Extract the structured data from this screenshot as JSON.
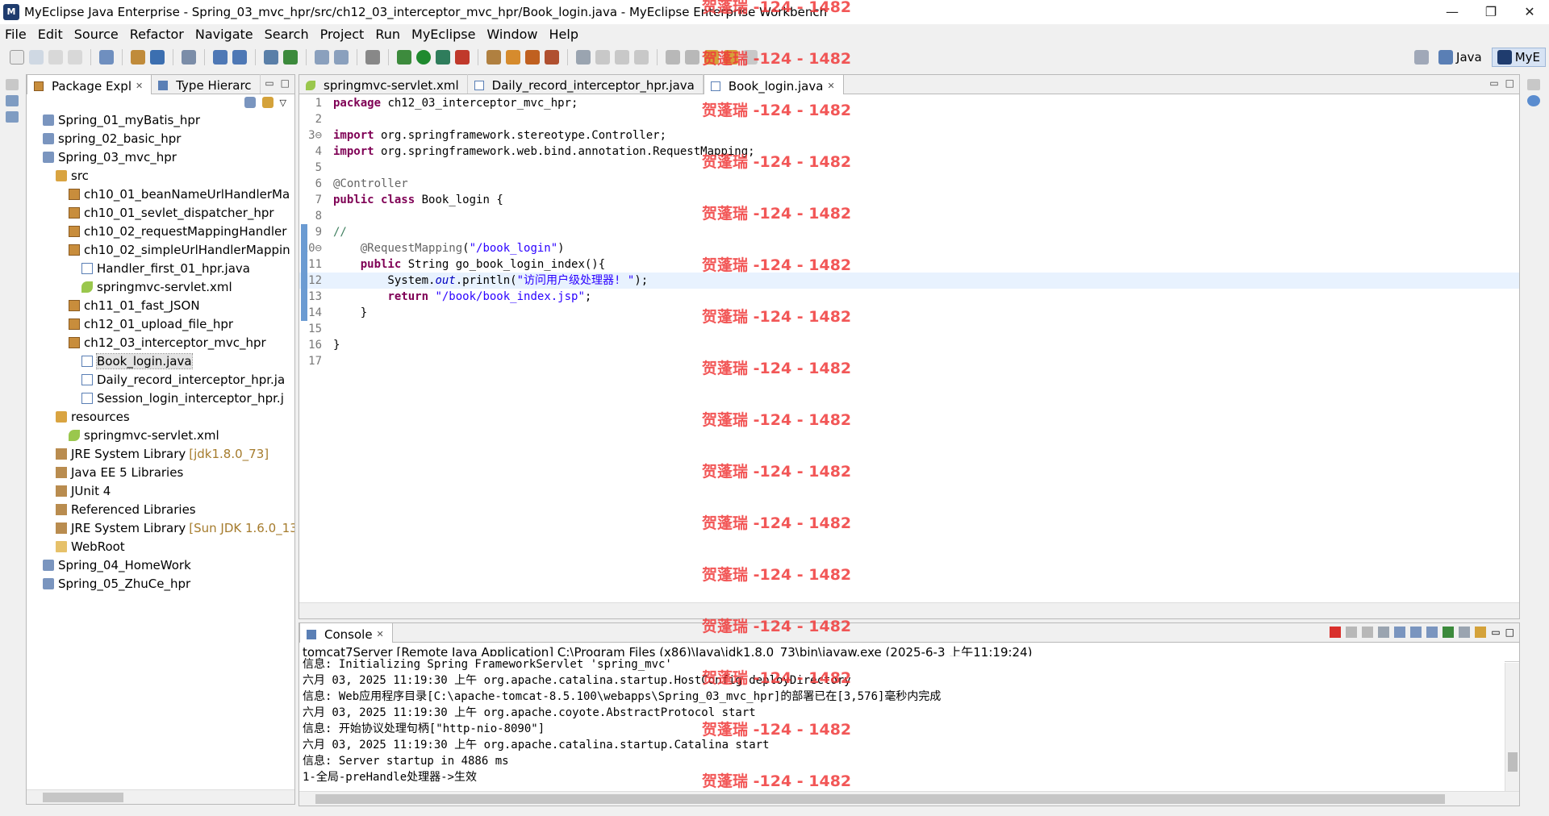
{
  "window": {
    "title": "MyEclipse Java Enterprise - Spring_03_mvc_hpr/src/ch12_03_interceptor_mvc_hpr/Book_login.java - MyEclipse Enterprise Workbench",
    "minimize": "—",
    "maximize": "❐",
    "close": "✕"
  },
  "menu": [
    "File",
    "Edit",
    "Source",
    "Refactor",
    "Navigate",
    "Search",
    "Project",
    "Run",
    "MyEclipse",
    "Window",
    "Help"
  ],
  "perspectives": {
    "java": "Java",
    "myeclipse": "MyE"
  },
  "explorer": {
    "tabs": [
      "Package Expl",
      "Type Hierarc"
    ],
    "tree": [
      {
        "label": "Spring_01_myBatis_hpr",
        "depth": 1,
        "icon": "project-icon"
      },
      {
        "label": "spring_02_basic_hpr",
        "depth": 1,
        "icon": "project-icon"
      },
      {
        "label": "Spring_03_mvc_hpr",
        "depth": 1,
        "icon": "project-icon"
      },
      {
        "label": "src",
        "depth": 2,
        "icon": "source-folder-icon"
      },
      {
        "label": "ch10_01_beanNameUrlHandlerMa",
        "depth": 3,
        "icon": "package-icon"
      },
      {
        "label": "ch10_01_sevlet_dispatcher_hpr",
        "depth": 3,
        "icon": "package-icon"
      },
      {
        "label": "ch10_02_requestMappingHandler",
        "depth": 3,
        "icon": "package-icon"
      },
      {
        "label": "ch10_02_simpleUrlHandlerMappin",
        "depth": 3,
        "icon": "package-icon"
      },
      {
        "label": "Handler_first_01_hpr.java",
        "depth": 4,
        "icon": "java-file-icon"
      },
      {
        "label": "springmvc-servlet.xml",
        "depth": 4,
        "icon": "xml-file-icon"
      },
      {
        "label": "ch11_01_fast_JSON",
        "depth": 3,
        "icon": "package-icon"
      },
      {
        "label": "ch12_01_upload_file_hpr",
        "depth": 3,
        "icon": "package-icon"
      },
      {
        "label": "ch12_03_interceptor_mvc_hpr",
        "depth": 3,
        "icon": "package-icon"
      },
      {
        "label": "Book_login.java",
        "depth": 4,
        "icon": "java-file-icon",
        "selected": true
      },
      {
        "label": "Daily_record_interceptor_hpr.ja",
        "depth": 4,
        "icon": "java-file-icon"
      },
      {
        "label": "Session_login_interceptor_hpr.j",
        "depth": 4,
        "icon": "java-file-icon"
      },
      {
        "label": "resources",
        "depth": 2,
        "icon": "source-folder-icon"
      },
      {
        "label": "springmvc-servlet.xml",
        "depth": 3,
        "icon": "xml-file-icon"
      },
      {
        "label": "JRE System Library",
        "depth": 2,
        "icon": "library-icon",
        "decor": "[jdk1.8.0_73]"
      },
      {
        "label": "Java EE 5 Libraries",
        "depth": 2,
        "icon": "library-icon"
      },
      {
        "label": "JUnit 4",
        "depth": 2,
        "icon": "library-icon"
      },
      {
        "label": "Referenced Libraries",
        "depth": 2,
        "icon": "library-icon"
      },
      {
        "label": "JRE System Library",
        "depth": 2,
        "icon": "library-icon",
        "decor": "[Sun JDK 1.6.0_13]"
      },
      {
        "label": "WebRoot",
        "depth": 2,
        "icon": "folder-icon"
      },
      {
        "label": "Spring_04_HomeWork",
        "depth": 1,
        "icon": "project-icon"
      },
      {
        "label": "Spring_05_ZhuCe_hpr",
        "depth": 1,
        "icon": "project-icon"
      }
    ]
  },
  "editor": {
    "tabs": [
      "springmvc-servlet.xml",
      "Daily_record_interceptor_hpr.java",
      "Book_login.java"
    ],
    "active_tab": 2,
    "lines": [
      {
        "n": "1",
        "parts": [
          [
            "kw",
            "package"
          ],
          [
            "",
            " ch12_03_interceptor_mvc_hpr;"
          ]
        ]
      },
      {
        "n": "2",
        "parts": []
      },
      {
        "n": "3⊖",
        "parts": [
          [
            "kw",
            "import"
          ],
          [
            "",
            " org.springframework.stereotype.Controller;"
          ]
        ]
      },
      {
        "n": "4",
        "parts": [
          [
            "kw",
            "import"
          ],
          [
            "",
            " org.springframework.web.bind.annotation.RequestMapping;"
          ]
        ]
      },
      {
        "n": "5",
        "parts": []
      },
      {
        "n": "6",
        "parts": [
          [
            "ann",
            "@Controller"
          ]
        ]
      },
      {
        "n": "7",
        "parts": [
          [
            "kw",
            "public"
          ],
          [
            "",
            " "
          ],
          [
            "kw",
            "class"
          ],
          [
            "",
            " Book_login {"
          ]
        ]
      },
      {
        "n": "8",
        "parts": []
      },
      {
        "n": "9",
        "parts": [
          [
            "cmt",
            "//"
          ]
        ],
        "mark": true
      },
      {
        "n": "10⊖",
        "parts": [
          [
            "",
            " "
          ],
          [
            "ann",
            "   @RequestMapping"
          ],
          [
            "",
            "("
          ],
          [
            "str",
            "\"/book_login\""
          ],
          [
            "",
            ")"
          ]
        ],
        "mark": true
      },
      {
        "n": "11",
        "parts": [
          [
            "",
            "    "
          ],
          [
            "kw",
            "public"
          ],
          [
            "",
            " String go_book_login_index(){"
          ]
        ],
        "mark": true
      },
      {
        "n": "12",
        "parts": [
          [
            "",
            "        System."
          ],
          [
            "field",
            "out"
          ],
          [
            "",
            ".println("
          ],
          [
            "str",
            "\"访问用户级处理器! \""
          ],
          [
            "",
            ");"
          ]
        ],
        "mark": true,
        "current": true
      },
      {
        "n": "13",
        "parts": [
          [
            "",
            "        "
          ],
          [
            "kw",
            "return"
          ],
          [
            "",
            " "
          ],
          [
            "str",
            "\"/book/book_index.jsp\""
          ],
          [
            "",
            ";"
          ]
        ],
        "mark": true
      },
      {
        "n": "14",
        "parts": [
          [
            "",
            "    }"
          ]
        ],
        "mark": true
      },
      {
        "n": "15",
        "parts": []
      },
      {
        "n": "16",
        "parts": [
          [
            "",
            "}"
          ]
        ]
      },
      {
        "n": "17",
        "parts": []
      }
    ]
  },
  "console": {
    "tab": "Console",
    "header": "tomcat7Server [Remote Java Application] C:\\Program Files (x86)\\Java\\jdk1.8.0_73\\bin\\javaw.exe (2025-6-3 上午11:19:24)",
    "lines": [
      "信息: Initializing Spring FrameworkServlet 'spring_mvc'",
      "六月 03, 2025 11:19:30 上午 org.apache.catalina.startup.HostConfig deployDirectory",
      "信息: Web应用程序目录[C:\\apache-tomcat-8.5.100\\webapps\\Spring_03_mvc_hpr]的部署已在[3,576]毫秒内完成",
      "六月 03, 2025 11:19:30 上午 org.apache.coyote.AbstractProtocol start",
      "信息: 开始协议处理句柄[\"http-nio-8090\"]",
      "六月 03, 2025 11:19:30 上午 org.apache.catalina.startup.Catalina start",
      "信息: Server startup in 4886 ms",
      "1-全局-preHandle处理器->生效"
    ]
  },
  "watermark": "贺蓬瑞 -124 - 1482",
  "colors": {
    "keyword": "#7f0055",
    "string": "#2a00ff",
    "annotation": "#646464",
    "comment": "#3f7f5f",
    "watermark": "#f03a3a"
  }
}
